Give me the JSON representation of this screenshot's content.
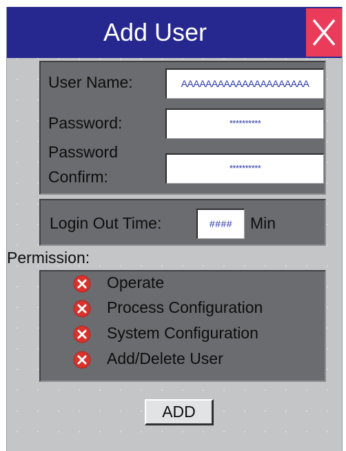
{
  "window": {
    "title": "Add User",
    "close_icon": "close-icon"
  },
  "credentials": {
    "username_label": "User Name:",
    "username_value": "AAAAAAAAAAAAAAAAAAAAA",
    "password_label": "Password:",
    "password_value": "**********",
    "confirm_label_line1": "Password",
    "confirm_label_line2": "Confirm:",
    "confirm_value": "**********"
  },
  "timeout": {
    "label": "Login Out Time:",
    "value": "####",
    "unit": "Min"
  },
  "permissions": {
    "heading": "Permission:",
    "state_icon": "unchecked-x-icon",
    "items": [
      {
        "label": "Operate"
      },
      {
        "label": "Process Configuration"
      },
      {
        "label": "System Configuration"
      },
      {
        "label": "Add/Delete User"
      }
    ]
  },
  "actions": {
    "add_label": "ADD"
  },
  "colors": {
    "title_bar": "#27288f",
    "close_button": "#ea3b5b",
    "background": "#c4c5c7",
    "panel": "#6b6c70",
    "field_text": "#2b3aa6",
    "permission_icon": "#d8322d"
  }
}
